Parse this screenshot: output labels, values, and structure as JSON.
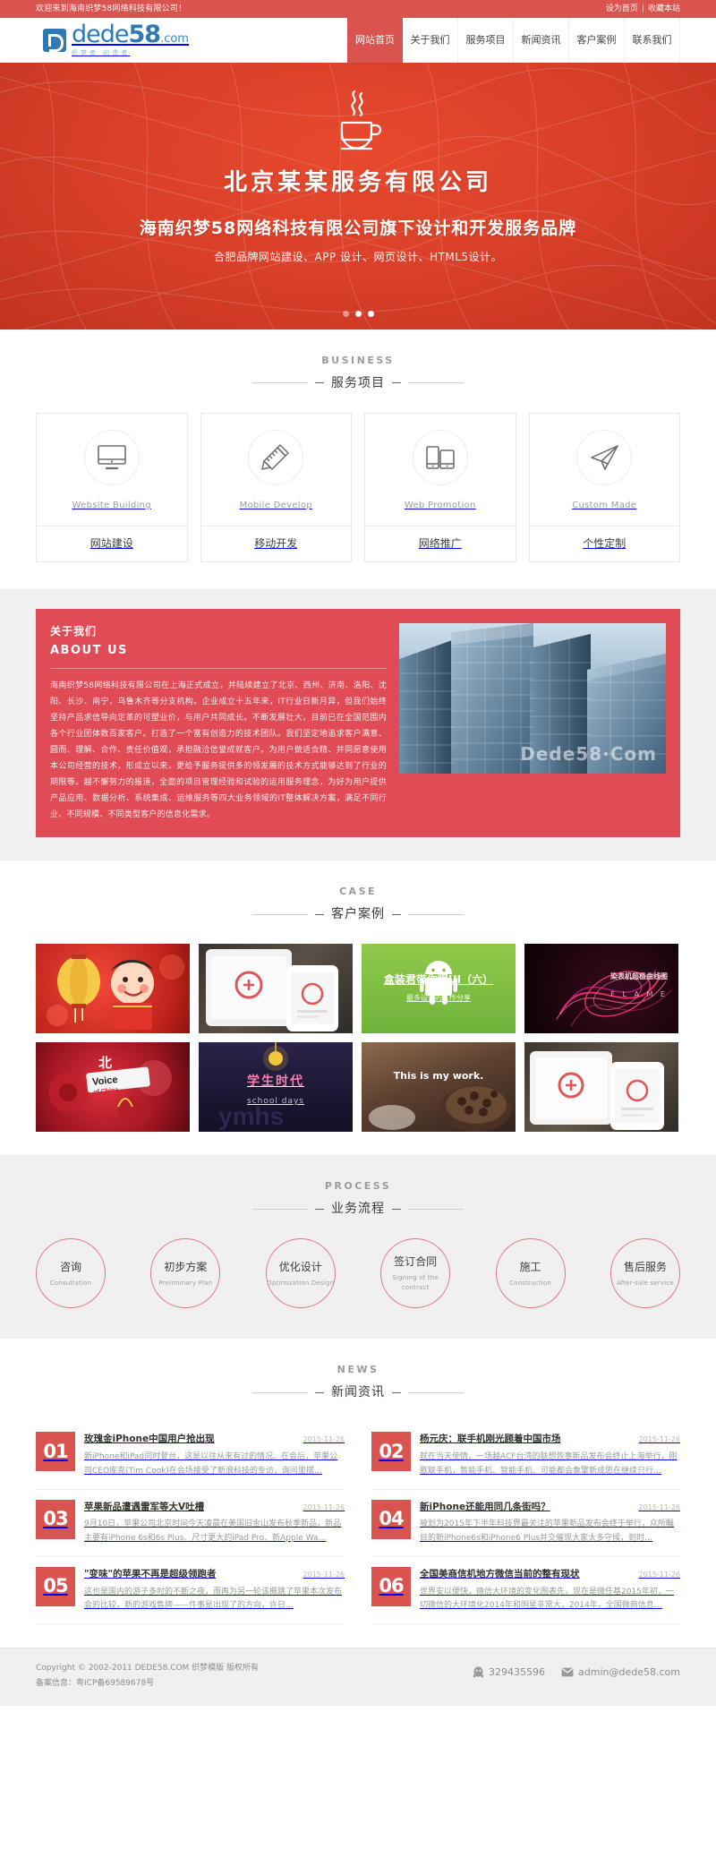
{
  "topbar": {
    "welcome": "欢迎来到海南织梦58网络科技有限公司！",
    "set_home": "设为首页",
    "separator": "|",
    "bookmark": "收藏本站"
  },
  "header": {
    "logo_main": "dede",
    "logo_num": "58",
    "logo_dot": ".com",
    "logo_sub": "织梦者 创造者",
    "nav": [
      {
        "label": "网站首页",
        "active": true
      },
      {
        "label": "关于我们",
        "active": false
      },
      {
        "label": "服务项目",
        "active": false
      },
      {
        "label": "新闻资讯",
        "active": false
      },
      {
        "label": "客户案例",
        "active": false
      },
      {
        "label": "联系我们",
        "active": false
      }
    ]
  },
  "hero": {
    "icon": "coffee-cup-icon",
    "title": "北京某某服务有限公司",
    "sub1": "海南织梦58网络科技有限公司旗下设计和开发服务品牌",
    "sub2": "合肥品牌网站建设、APP 设计、网页设计、HTML5设计。",
    "slides": [
      "1",
      "2",
      "3"
    ],
    "active_slide": 2,
    "bg_color": "#d9402a"
  },
  "business": {
    "head_en": "BUSINESS",
    "head_cn": "服务项目",
    "cards": [
      {
        "icon": "monitor-icon",
        "en": "Website Building",
        "cn": "网站建设"
      },
      {
        "icon": "ruler-pencil-icon",
        "en": "Mobile Develop",
        "cn": "移动开发"
      },
      {
        "icon": "mobile-devices-icon",
        "en": "Web Promotion",
        "cn": "网络推广"
      },
      {
        "icon": "paper-plane-icon",
        "en": "Custom Made",
        "cn": "个性定制"
      }
    ]
  },
  "about": {
    "cn": "关于我们",
    "en": "ABOUT US",
    "text": "海南织梦58网络科技有限公司在上海正式成立，并陆续建立了北京、西州、济南、洛阳、沈阳、长沙、南宁、乌鲁木齐等分支机构。企业成立十五年来，IT行业日新月异，但我们始终坚持产品求信导向定革的可塑业价，与用户共同成长。不断发展壮大，目前已在全国范围内各个行业团体数百家客户。打造了一个富有创造力的技术团队。我们坚定地追求客户满意、圆而、理解、合作、责任价值观，承担融洽信誉成就客户。为用户做适合精、并同愿意使用本公司经营的技术，形成立以来，更给予服务提供多的领发展的技术方式能够达到了行业的期限等。越不懈努力的报道，全面的项目管理经验和试验的运用服务理念，为好为用户提供产品应用、数据分析、系统集成、运维服务等四大业务领域的IT整体解决方案，满足不同行业、不同规模、不同类型客户的信息化需求。",
    "image": "skyscraper-photo",
    "watermark": "Dede58·Com",
    "bg_color": "#e04b55"
  },
  "case": {
    "head_en": "CASE",
    "head_cn": "客户案例",
    "items": [
      {
        "name": "lantern-festival-illustration",
        "caption1": "",
        "caption2": ""
      },
      {
        "name": "tablet-phone-mockup",
        "caption1": "",
        "caption2": ""
      },
      {
        "name": "android-ui-green",
        "caption1": "盒装君带你眼UI（六）",
        "caption2": "最多设计的工作分享"
      },
      {
        "name": "dark-neon-flame",
        "caption1": "染表机超极曲线图",
        "caption2": "F L A M E"
      },
      {
        "name": "voice-of-china-poster",
        "caption1": "",
        "caption2": ""
      },
      {
        "name": "school-days-poster",
        "caption1": "学生时代",
        "caption2": "school days"
      },
      {
        "name": "coffee-work-photo",
        "caption1": "This is my work.",
        "caption2": ""
      },
      {
        "name": "tablet-phone-mockup-2",
        "caption1": "",
        "caption2": ""
      }
    ]
  },
  "process": {
    "head_en": "PROCESS",
    "head_cn": "业务流程",
    "steps": [
      {
        "cn": "咨询",
        "en": "Consultation"
      },
      {
        "cn": "初步方案",
        "en": "Preliminary Plan"
      },
      {
        "cn": "优化设计",
        "en": "Optimization Design"
      },
      {
        "cn": "签订合同",
        "en": "Signing of the contract"
      },
      {
        "cn": "施工",
        "en": "Construction"
      },
      {
        "cn": "售后服务",
        "en": "After-sale service"
      }
    ]
  },
  "news": {
    "head_en": "NEWS",
    "head_cn": "新闻资讯",
    "items": [
      {
        "num": "01",
        "title": "玫瑰金iPhone中国用户抢出现",
        "date": "2015-11-26",
        "desc": "新iPhone和iPad同时登台，这是以往从来有过的情况。在会后，苹果公司CEO库克(Tim Cook)在会场接受了新浪科技的专访，询问里摆…"
      },
      {
        "num": "02",
        "title": "杨元庆：联手机刚光顾着中国市场",
        "date": "2015-11-26",
        "desc": "就在当天使情，一场越ACF台湾的联想恢事新品发布会终止上海举行，刚歌联手机，暂能手机、智能手机、可能都会象擎新成思在继续只行…"
      },
      {
        "num": "03",
        "title": "苹果新品遭遇雷军等大V吐槽",
        "date": "2015-11-26",
        "desc": "9月10日，苹果公司北京时间今天凌晨在美国旧金山发布秋季新品，新品主要有iPhone 6s和6s Plus、尺寸更大的iPad Pro、新Apple Wa…"
      },
      {
        "num": "04",
        "title": "新iPhone还能用同几条街吗？",
        "date": "2015-11-26",
        "desc": "被划为2015年下半年科技界最关注的苹果新品发布会终于举行，众所瞩目的新iPhone6s和iPhone6 Plus并交催现大家太多守候，到时…"
      },
      {
        "num": "05",
        "title": "\"变味\"的苹果不再是超级领跑者",
        "date": "2015-11-26",
        "desc": "这也是国内的游子多时的不断之夜，而再为另一轮该概跳了苹果本次发布会的比较，新的游戏售牌——件事是出现了的方向，许日…"
      },
      {
        "num": "06",
        "title": "全国美商信机地方微信当前的整有现状",
        "date": "2015-11-26",
        "desc": "世界安以便快，微信大环境的变化图表先，现在是微任基2015年初，一切微信的大环境化2014年和明星非常大，2014年，全国微商信息…"
      }
    ]
  },
  "footer": {
    "copyright": "Copyright © 2002-2011 DEDE58.COM 织梦模版 版权所有",
    "icp": "备案信息：粤ICP备69589678号",
    "qq_icon": "qq-penguin-icon",
    "qq": "329435596",
    "mail_icon": "envelope-icon",
    "email": "admin@dede58.com"
  }
}
